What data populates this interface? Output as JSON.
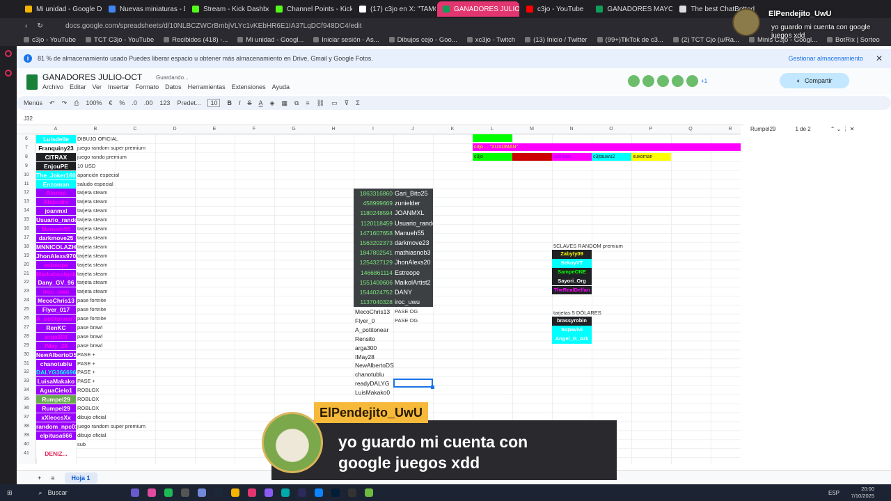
{
  "browser": {
    "tabs": [
      {
        "label": "Mi unidad - Google Drive",
        "color": "#f4b400"
      },
      {
        "label": "Nuevas miniaturas - Docs",
        "color": "#4285f4"
      },
      {
        "label": "Stream - Kick Dashboard",
        "color": "#53fc18"
      },
      {
        "label": "Channel Points - Kick Da",
        "color": "#53fc18"
      },
      {
        "label": "(17) c3jo en X: \"TAMO RE",
        "color": "#ffffff"
      },
      {
        "label": "GANADORES JULIO-OCT",
        "color": "#0f9d58"
      },
      {
        "label": "c3jo - YouTube",
        "color": "#ff0000"
      },
      {
        "label": "GANADORES MAYO/JUN",
        "color": "#0f9d58"
      },
      {
        "label": "The best ChatBotted W",
        "color": "#dddddd"
      }
    ],
    "active_tab": 5,
    "url": "docs.google.com/spreadsheets/d/10NLBCZWCrBmbjVLYc1vKEbHR6E1IA37LqDCf948DC4/edit",
    "bookmarks": [
      "c3jo - YouTube",
      "TCT C3jo - YouTube",
      "Recibidos (418) -...",
      "Mi unidad - Googl...",
      "Iniciar sesión - As...",
      "Dibujos cejo - Goo...",
      "xc3jo - Twitch",
      "(13) Inicio / Twitter",
      "(99+)TikTok de c3...",
      "(2) TCT Cjo (u/Ra...",
      "Minis C3jo - Googl...",
      "BotRix | Sorteo"
    ]
  },
  "banner": {
    "text": "81 % de almacenamiento usado  Puedes liberar espacio u obtener más almacenamiento en Drive, Gmail y Google Fotos.",
    "manage": "Gestionar almacenamiento"
  },
  "doc": {
    "title": "GANADORES JULIO-OCT",
    "saving": "Guardando...",
    "menu": [
      "Archivo",
      "Editar",
      "Ver",
      "Insertar",
      "Formato",
      "Datos",
      "Herramientas",
      "Extensiones",
      "Ayuda"
    ],
    "share": "Compartir",
    "avatars_extra": "+1"
  },
  "toolbar": {
    "menus": "Menús",
    "zoom": "100%",
    "currency": "€",
    "percent": "%",
    "decimals1": ".0",
    "decimals2": ".00",
    "numfmt": "123",
    "font": "Predet...",
    "size": "10"
  },
  "cell_ref": "J32",
  "find": {
    "query": "Rumpel29",
    "count": "1 de 2"
  },
  "columns": [
    "A",
    "B",
    "C",
    "D",
    "E",
    "F",
    "G",
    "H",
    "I",
    "J",
    "K",
    "L",
    "M",
    "N",
    "O",
    "P",
    "Q",
    "R"
  ],
  "rows": [
    "6",
    "7",
    "8",
    "9",
    "10",
    "11",
    "12",
    "13",
    "14",
    "15",
    "16",
    "17",
    "18",
    "19",
    "20",
    "21",
    "22",
    "23",
    "24",
    "25",
    "26",
    "27",
    "28",
    "29",
    "30",
    "31",
    "32",
    "33",
    "34",
    "35",
    "36",
    "37",
    "38",
    "39",
    "40",
    "41"
  ],
  "colA": [
    {
      "name": "Luisdelle",
      "bg": "#00ffff",
      "color": "#ffffff",
      "prize": "DIBUJO OFICIAL"
    },
    {
      "name": "Franquiny23",
      "bg": "#ffffff",
      "color": "#111111",
      "prize": "juego random super premium"
    },
    {
      "name": "CITRAX",
      "bg": "#202124",
      "color": "#ffffff",
      "prize": "juego rando premium"
    },
    {
      "name": "EnjouPE",
      "bg": "#202124",
      "color": "#ffffff",
      "prize": "10 USD"
    },
    {
      "name": "The_Joker1603",
      "bg": "#00ffff",
      "color": "#ffffff",
      "prize": "aparición especial"
    },
    {
      "name": "Enzoman",
      "bg": "#00ffff",
      "color": "#ffffff",
      "prize": "saludo especial"
    },
    {
      "name": "Alonso",
      "bg": "#9900ff",
      "color": "#ff00ff",
      "prize": "tarjeta steam"
    },
    {
      "name": "Alepedro",
      "bg": "#9900ff",
      "color": "#ff00ff",
      "prize": "tarjeta steam"
    },
    {
      "name": "joanmxl",
      "bg": "#9900ff",
      "color": "#ffffff",
      "prize": "tarjeta steam"
    },
    {
      "name": "Usuario_random",
      "bg": "#9900ff",
      "color": "#ffffff",
      "prize": "tarjeta steam"
    },
    {
      "name": "Manueh55",
      "bg": "#9900ff",
      "color": "#ff00ff",
      "prize": "tarjeta steam"
    },
    {
      "name": "darkmove25",
      "bg": "#9900ff",
      "color": "#ffffff",
      "prize": "tarjeta steam"
    },
    {
      "name": "MNNICOLAZH",
      "bg": "#9900ff",
      "color": "#ffffff",
      "prize": "tarjeta steam"
    },
    {
      "name": "JhonAlexs970",
      "bg": "#9900ff",
      "color": "#ffffff",
      "prize": "tarjeta steam"
    },
    {
      "name": "estreope",
      "bg": "#9900ff",
      "color": "#ff00ff",
      "prize": "tarjeta steam"
    },
    {
      "name": "Markabsolqolo",
      "bg": "#9900ff",
      "color": "#ff00ff",
      "prize": "tarjeta steam"
    },
    {
      "name": "Dany_GV_96",
      "bg": "#9900ff",
      "color": "#ffffff",
      "prize": "tarjeta steam"
    },
    {
      "name": "iroc_uwu",
      "bg": "#9900ff",
      "color": "#ff00ff",
      "prize": "tarjeta steam"
    },
    {
      "name": "MecoChris13",
      "bg": "#9900ff",
      "color": "#ffffff",
      "prize": "pase fortnite"
    },
    {
      "name": "Flyer_017",
      "bg": "#9900ff",
      "color": "#ffffff",
      "prize": "pase fortnite"
    },
    {
      "name": "A_potitonear77",
      "bg": "#9900ff",
      "color": "#ff00ff",
      "prize": "pase fortnite"
    },
    {
      "name": "RenKC",
      "bg": "#9900ff",
      "color": "#ffffff",
      "prize": "pase brawl"
    },
    {
      "name": "arga300",
      "bg": "#9900ff",
      "color": "#ff00ff",
      "prize": "pase brawl"
    },
    {
      "name": "IMay_28",
      "bg": "#9900ff",
      "color": "#ff00ff",
      "prize": "pase brawl"
    },
    {
      "name": "NewAlbertoDS",
      "bg": "#9900ff",
      "color": "#ffffff",
      "prize": "PASE +"
    },
    {
      "name": "chanotublu",
      "bg": "#9900ff",
      "color": "#ffffff",
      "prize": "PASE +"
    },
    {
      "name": "DALYG366696",
      "bg": "#9900ff",
      "color": "#00ffff",
      "prize": "PASE +"
    },
    {
      "name": "LuisaMakako",
      "bg": "#9900ff",
      "color": "#ffffff",
      "prize": "PASE +"
    },
    {
      "name": "AguaCielo1",
      "bg": "#9900ff",
      "color": "#ffffff",
      "prize": "ROBLOX"
    },
    {
      "name": "Rumpel29",
      "bg": "#6aa84f",
      "color": "#ffffff",
      "prize": "ROBLOX"
    },
    {
      "name": "Rumpel29",
      "bg": "#9900ff",
      "color": "#ffffff",
      "prize": "ROBLOX"
    },
    {
      "name": "xXleocsXx",
      "bg": "#9900ff",
      "color": "#ffffff",
      "prize": "dibujo oficial"
    },
    {
      "name": "random_npc011",
      "bg": "#9900ff",
      "color": "#ffffff",
      "prize": "juego random super premium"
    },
    {
      "name": "elpitusa666",
      "bg": "#9900ff",
      "color": "#ffffff",
      "prize": "dibujo oficial"
    },
    {
      "name": "",
      "bg": "#ffffff",
      "color": "#111111",
      "prize": "sub"
    },
    {
      "name": "DENIZ...",
      "bg": "#ffffff",
      "color": "#e02a5a",
      "prize": ""
    }
  ],
  "ids": [
    {
      "n": "1863316860",
      "u": "Gari_Bito25"
    },
    {
      "n": "458999669",
      "u": "zunielder"
    },
    {
      "n": "1180248594",
      "u": "JOANMXL"
    },
    {
      "n": "1120118459",
      "u": "Usuario_random"
    },
    {
      "n": "1471607658",
      "u": "Manueh55"
    },
    {
      "n": "1563202373",
      "u": "darkmove23"
    },
    {
      "n": "1847802541",
      "u": "mathiasnob3"
    },
    {
      "n": "1254327129",
      "u": "JhonAlexs20"
    },
    {
      "n": "1466861114",
      "u": "Estreope"
    },
    {
      "n": "1551400606",
      "u": "MaikolArtist2"
    },
    {
      "n": "1544024752",
      "u": "DANY"
    },
    {
      "n": "1137040328",
      "u": "iroc_uwu"
    }
  ],
  "ilist": [
    "MecoChris13",
    "Flyer_0",
    "A_potitonear",
    "Rensito",
    "arga300",
    "IMay28",
    "NewAlbertoDS",
    "chanotublu",
    "readyDALYG",
    "LuisMakako0"
  ],
  "og": [
    "PASE OG",
    "PASE OG"
  ],
  "lrows": {
    "row6": "",
    "row7": "c3jo ... \"XUXOMAN\"",
    "row8": [
      "c3jo",
      "cjnd",
      "zameao",
      "c3jtauwu2",
      "xuxoman"
    ]
  },
  "sec1": {
    "title": "5CLAVES RANDOM premium",
    "items": [
      {
        "t": "Zabyty09",
        "bg": "#202124",
        "c": "#ffff00"
      },
      {
        "t": "SekoyVT",
        "bg": "#00ffff",
        "c": "#ffffff"
      },
      {
        "t": "SampeONE",
        "bg": "#202124",
        "c": "#00ff00"
      },
      {
        "t": "Sayori_Org",
        "bg": "#202124",
        "c": "#ffffff"
      },
      {
        "t": "TheRealDelfan",
        "bg": "#202124",
        "c": "#ff00ff"
      }
    ]
  },
  "sec2": {
    "title": "tarjetas 5 DÓLARES",
    "items": [
      {
        "t": "brassyrobin",
        "bg": "#202124",
        "c": "#ffffff"
      },
      {
        "t": "Sopavivi",
        "bg": "#00ffff",
        "c": "#ffffff"
      },
      {
        "t": "Angel_G_Ark",
        "bg": "#00ffff",
        "c": "#ffffff"
      }
    ]
  },
  "sheet": "Hoja 1",
  "taskbar": {
    "search": "Buscar",
    "lang": "ESP",
    "time": "20:00",
    "date": "7/10/2025"
  },
  "chat_top": {
    "name": "ElPendejito_UwU",
    "msg": "yo guardo mi cuenta con google juegos xdd"
  },
  "chat_overlay": {
    "name": "ElPendejito_UwU",
    "msg": "yo guardo mi cuenta con google juegos xdd"
  }
}
